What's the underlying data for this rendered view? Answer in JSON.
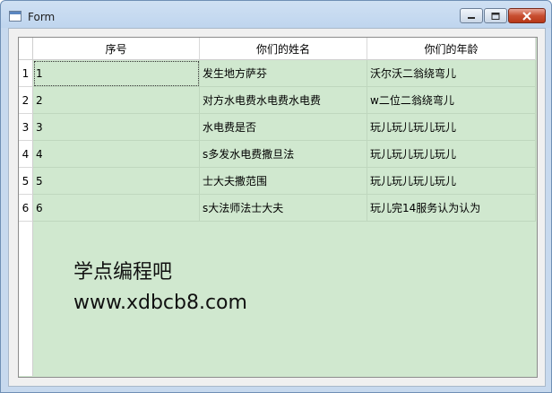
{
  "window": {
    "title": "Form",
    "icon": "window-icon"
  },
  "table": {
    "columns": [
      "序号",
      "你们的姓名",
      "你们的年龄"
    ],
    "row_numbers": [
      "1",
      "2",
      "3",
      "4",
      "5",
      "6"
    ],
    "rows": [
      [
        "1",
        "发生地方萨芬",
        "沃尔沃二翁绕弯儿"
      ],
      [
        "2",
        "对方水电费水电费水电费",
        "w二位二翁绕弯儿"
      ],
      [
        "3",
        "水电费是否",
        "玩儿玩儿玩儿玩儿"
      ],
      [
        "4",
        "s多发水电费撒旦法",
        "玩儿玩儿玩儿玩儿"
      ],
      [
        "5",
        "士大夫撒范围",
        "玩儿玩儿玩儿玩儿"
      ],
      [
        "6",
        "s大法师法士大夫",
        "玩儿完14服务认为认为"
      ]
    ],
    "focused_cell": "row 1, column 1",
    "background": "#d0e8cf"
  },
  "overlay": {
    "line1": "学点编程吧",
    "line2": "www.xdbcb8.com"
  }
}
